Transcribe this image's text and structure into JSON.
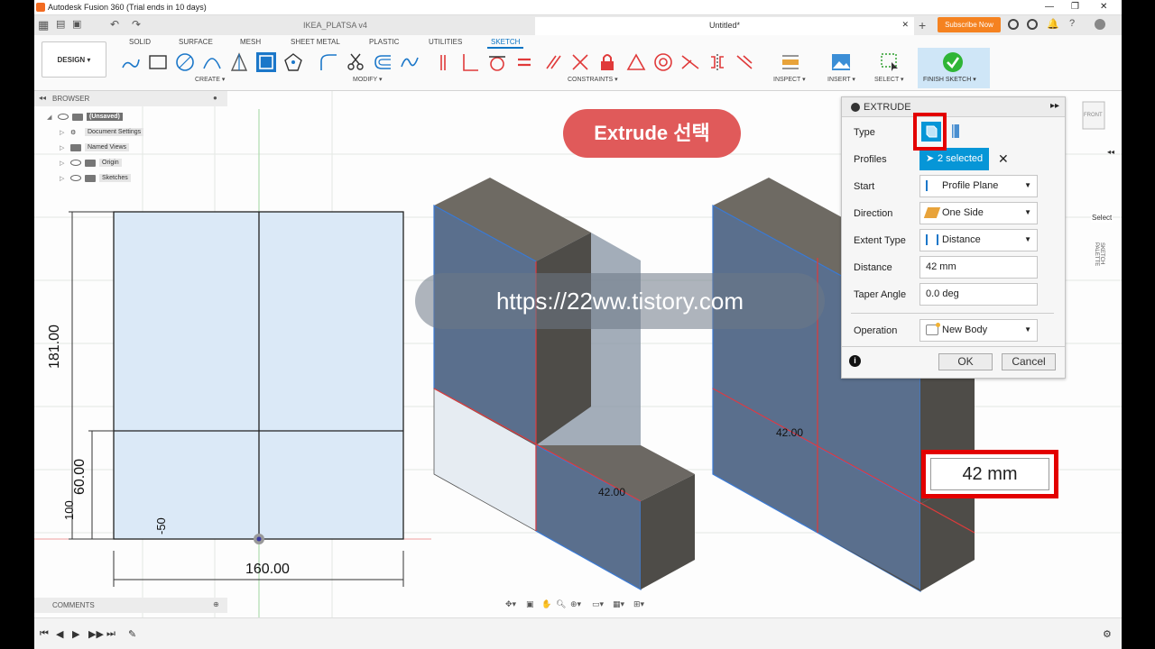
{
  "window": {
    "title": "Autodesk Fusion 360 (Trial ends in 10 days)"
  },
  "tabs": [
    {
      "label": "IKEA_PLATSA v4",
      "active": false
    },
    {
      "label": "Untitled*",
      "active": true
    }
  ],
  "subscribe_label": "Subscribe Now",
  "workspace_tabs": [
    "SOLID",
    "SURFACE",
    "MESH",
    "SHEET METAL",
    "PLASTIC",
    "UTILITIES",
    "SKETCH"
  ],
  "active_workspace_tab": "SKETCH",
  "design_label": "DESIGN ▾",
  "toolbar_groups": {
    "create": "CREATE ▾",
    "modify": "MODIFY ▾",
    "constraints": "CONSTRAINTS ▾",
    "inspect": "INSPECT ▾",
    "insert": "INSERT ▾",
    "select": "SELECT ▾",
    "finish": "FINISH SKETCH ▾"
  },
  "browser": {
    "title": "BROWSER",
    "items": [
      "(Unsaved)",
      "Document Settings",
      "Named Views",
      "Origin",
      "Sketches"
    ]
  },
  "comments_label": "COMMENTS",
  "extrude": {
    "title": "EXTRUDE",
    "labels": {
      "type": "Type",
      "profiles": "Profiles",
      "start": "Start",
      "direction": "Direction",
      "extent_type": "Extent Type",
      "distance": "Distance",
      "taper_angle": "Taper Angle",
      "operation": "Operation"
    },
    "profiles_value": "2 selected",
    "start_value": "Profile Plane",
    "direction_value": "One Side",
    "extent_value": "Distance",
    "distance_value": "42 mm",
    "taper_value": "0.0 deg",
    "operation_value": "New Body",
    "ok": "OK",
    "cancel": "Cancel"
  },
  "callout": "Extrude 선택",
  "watermark": "https://22ww.tistory.com",
  "distance_highlight": "42 mm",
  "sketch_dims": {
    "width": "160.00",
    "height": "181.00",
    "lower": "60.00",
    "offset": "-50",
    "small": "100",
    "extrude_3d": "42.00"
  },
  "view_cube_label": "FRONT",
  "side_panel": {
    "select": "Select",
    "sketch_palette": "SKETCH PALETTE"
  },
  "colors": {
    "accent": "#0696d7",
    "highlight": "#e30000",
    "callout": "#e05a5a",
    "subscribe": "#f58220"
  }
}
